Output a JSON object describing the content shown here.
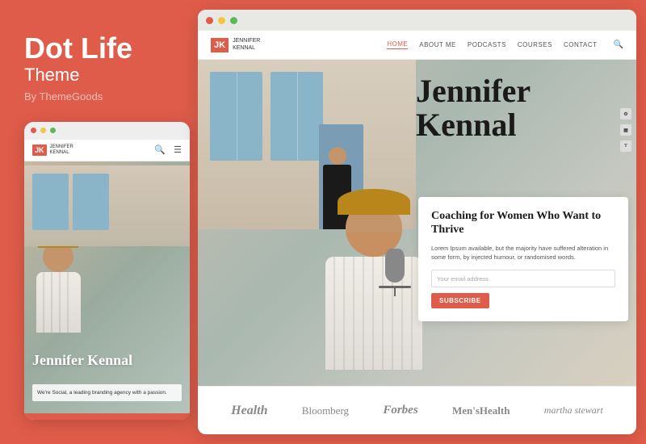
{
  "left": {
    "title": "Dot Life",
    "subtitle": "Theme",
    "by": "By ThemeGoods",
    "mobile": {
      "dots": [
        "red",
        "yellow",
        "green"
      ],
      "jk_logo": "JK",
      "jk_name1": "JENNIFER",
      "jk_name2": "KENNAL",
      "hero_title": "Jennifer Kennal",
      "hero_text": "We're Social, a leading branding agency with a passion."
    }
  },
  "right": {
    "dots": [
      "red",
      "yellow",
      "green"
    ],
    "nav": {
      "jk_logo": "JK",
      "jk_name1": "JENNIFER",
      "jk_name2": "KENNAL",
      "links": [
        "HOME",
        "ABOUT ME",
        "PODCASTS",
        "COURSES",
        "CONTACT"
      ],
      "active": "HOME"
    },
    "hero": {
      "title_line1": "Jennifer",
      "title_line2": "Kennal"
    },
    "coaching": {
      "title": "Coaching for Women Who Want to Thrive",
      "text": "Lorem Ipsum available, but the majority have suffered alteration in some form, by injected humour, or randomised words.",
      "input_placeholder": "Your email address",
      "button_label": "SUBSCRIBE"
    },
    "brands": [
      "Health",
      "Bloomberg",
      "Forbes",
      "Men'sHealth",
      "martha stewart"
    ]
  }
}
